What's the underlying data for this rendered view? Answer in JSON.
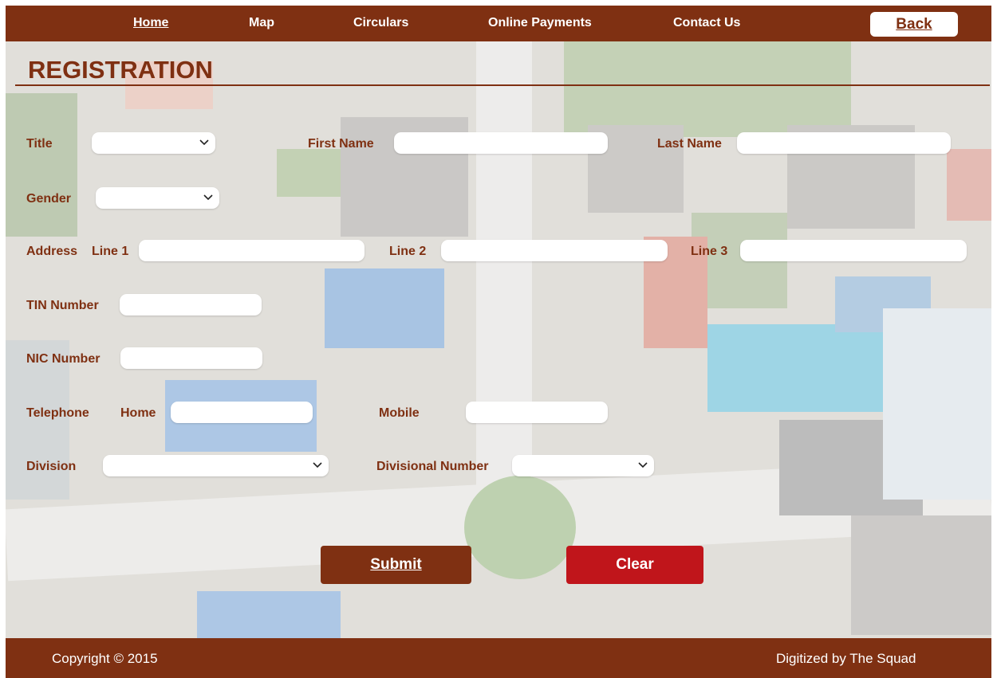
{
  "nav": {
    "items": [
      {
        "label": "Home",
        "active": true
      },
      {
        "label": "Map",
        "active": false
      },
      {
        "label": "Circulars",
        "active": false
      },
      {
        "label": "Online Payments",
        "active": false
      },
      {
        "label": "Contact Us",
        "active": false
      }
    ],
    "back_label": "Back"
  },
  "page": {
    "title": "REGISTRATION"
  },
  "form": {
    "title_label": "Title",
    "first_name_label": "First Name",
    "last_name_label": "Last Name",
    "gender_label": "Gender",
    "address_label": "Address",
    "line1_label": "Line 1",
    "line2_label": "Line 2",
    "line3_label": "Line 3",
    "tin_label": "TIN Number",
    "nic_label": "NIC Number",
    "telephone_label": "Telephone",
    "home_label": "Home",
    "mobile_label": "Mobile",
    "division_label": "Division",
    "divisional_number_label": "Divisional Number",
    "title_value": "",
    "first_name_value": "",
    "last_name_value": "",
    "gender_value": "",
    "line1_value": "",
    "line2_value": "",
    "line3_value": "",
    "tin_value": "",
    "nic_value": "",
    "home_value": "",
    "mobile_value": "",
    "division_value": "",
    "divisional_number_value": ""
  },
  "buttons": {
    "submit_label": "Submit",
    "clear_label": "Clear"
  },
  "footer": {
    "copyright": "Copyright © 2015",
    "credit": "Digitized by The Squad"
  },
  "colors": {
    "brand": "#7f3012",
    "clear_button": "#c0151b",
    "field": "#ffffff"
  },
  "icons": {
    "select_chevron": "chevron-down-icon"
  }
}
